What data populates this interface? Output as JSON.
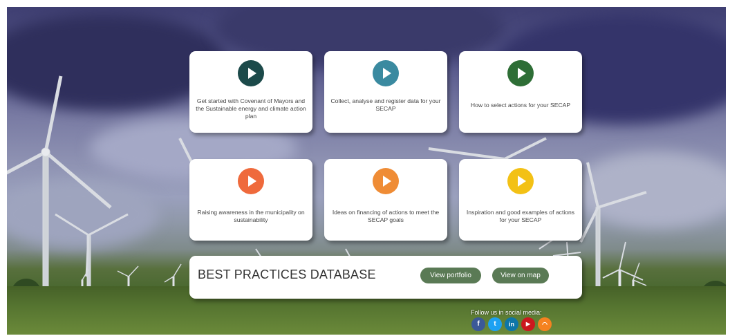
{
  "cards": [
    {
      "text": "Get started with Covenant of Mayors and the Sustainable energy and climate action plan",
      "color": "#1c4a4a"
    },
    {
      "text": "Collect, analyse and register data for your SECAP",
      "color": "#3a8aa0"
    },
    {
      "text": "How to select actions for your SECAP",
      "color": "#2e6e36"
    },
    {
      "text": "Raising awareness in the municipality on sustainability",
      "color": "#ef6a3c"
    },
    {
      "text": "Ideas on financing of actions to meet the SECAP goals",
      "color": "#ef8c35"
    },
    {
      "text": "Inspiration and good examples of actions for your SECAP",
      "color": "#f3c115"
    }
  ],
  "best_practices": {
    "title": "BEST PRACTICES DATABASE",
    "portfolio_button": "View portfolio",
    "map_button": "View on map",
    "button_color": "#5a7a55"
  },
  "social": {
    "label": "Follow us in social media:",
    "icons": [
      {
        "name": "facebook-icon",
        "glyph": "f",
        "color": "#3b5998"
      },
      {
        "name": "twitter-icon",
        "glyph": "t",
        "color": "#1da1f2"
      },
      {
        "name": "linkedin-icon",
        "glyph": "in",
        "color": "#0e76a8"
      },
      {
        "name": "youtube-icon",
        "glyph": "▶",
        "color": "#cc181e"
      },
      {
        "name": "rss-icon",
        "glyph": "◠",
        "color": "#f58220"
      }
    ]
  }
}
